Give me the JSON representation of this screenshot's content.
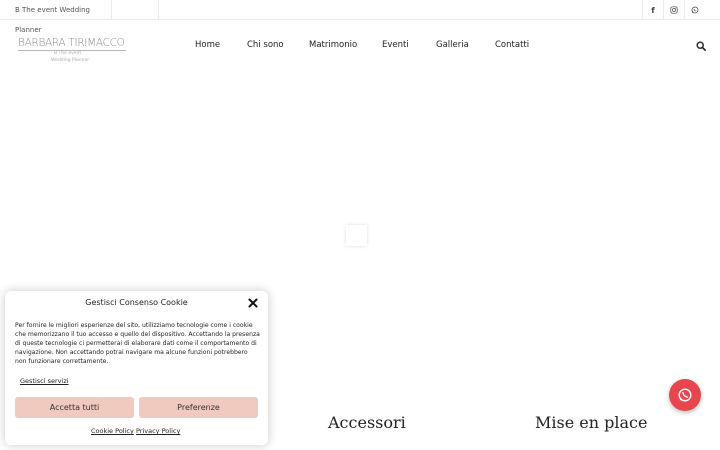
{
  "topbar": {
    "tagline": "B The event Wedding Planner",
    "social": [
      {
        "icon": "facebook-icon",
        "glyph": "f"
      },
      {
        "icon": "instagram-icon",
        "glyph": ""
      },
      {
        "icon": "whatsapp-icon",
        "glyph": ""
      }
    ]
  },
  "logo": {
    "main": "BARBARA TIRIMACCO",
    "sub1": "B The event",
    "sub2": "Wedding Planner"
  },
  "nav": {
    "items": [
      "Home",
      "Chi sono",
      "Matrimonio",
      "Eventi",
      "Galleria",
      "Contatti"
    ]
  },
  "sections": {
    "accessori": "Accessori",
    "mise_en_place": "Mise en place"
  },
  "cookie": {
    "title": "Gestisci Consenso Cookie",
    "text": "Per fornire le migliori esperienze del sito, utilizziamo tecnologie come i cookie che memorizzano il tuo accesso e quello del dispositivo. Accettando la presenza di queste tecnologie ci permetterai di elaborare dati come il comportamento di navigazione. Non accettando potrai navigare ma alcune funzioni potrebbero non funzionare correttamente.",
    "manage": "Gestisci servizi",
    "accept": "Accetta tutti",
    "preferences": "Preferenze",
    "cookie_policy": "Cookie Policy",
    "privacy_policy": "Privacy Policy"
  },
  "colors": {
    "accent_button": "#f0c9bf",
    "whatsapp_float": "#e8464f"
  }
}
